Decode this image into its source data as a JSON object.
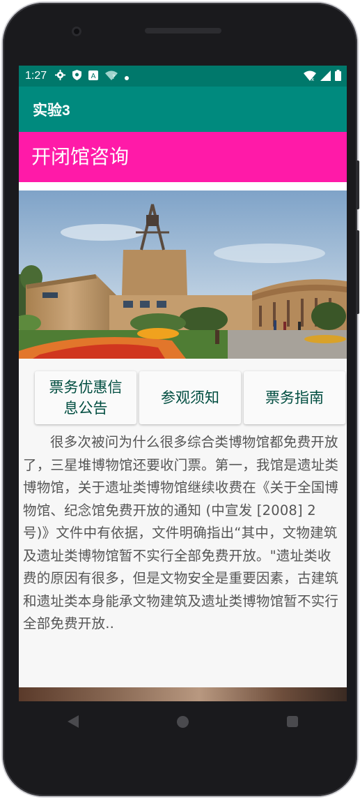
{
  "status_bar": {
    "time": "1:27",
    "icons_left": [
      "settings-gear-icon",
      "shield-icon",
      "keyboard-a-icon",
      "wifi-question-icon",
      "dot-icon"
    ],
    "icons_right": [
      "wifi-off-icon",
      "signal-icon",
      "battery-icon"
    ]
  },
  "app_bar": {
    "title": "实验3"
  },
  "section": {
    "title": "开闭馆咨询"
  },
  "photo": {
    "description_icon": "museum-photo"
  },
  "buttons": [
    {
      "label": "票务优惠信息公告"
    },
    {
      "label": "参观须知"
    },
    {
      "label": "票务指南"
    }
  ],
  "article": {
    "text": "很多次被问为什么很多综合类博物馆都免费开放了，三星堆博物馆还要收门票。第一，我馆是遗址类博物馆，关于遗址类博物馆继续收费在《关于全国博物馆、纪念馆免费开放的通知 (中宣发 [2008] 2号)》文件中有依据，文件明确指出“其中，文物建筑及遗址类博物馆暂不实行全部免费开放。\"遗址类收费的原因有很多，但是文物安全是重要因素，古建筑和遗址类本身能承文物建筑及遗址类博物馆暂不实行全部免费开放.."
  },
  "nav": {
    "back": "back-icon",
    "home": "home-icon",
    "recents": "recents-icon"
  },
  "colors": {
    "status_bar": "#00786b",
    "app_bar": "#008a7e",
    "section_bar": "#ff1aa8",
    "button_text": "#004d40",
    "article_text": "#555555"
  }
}
